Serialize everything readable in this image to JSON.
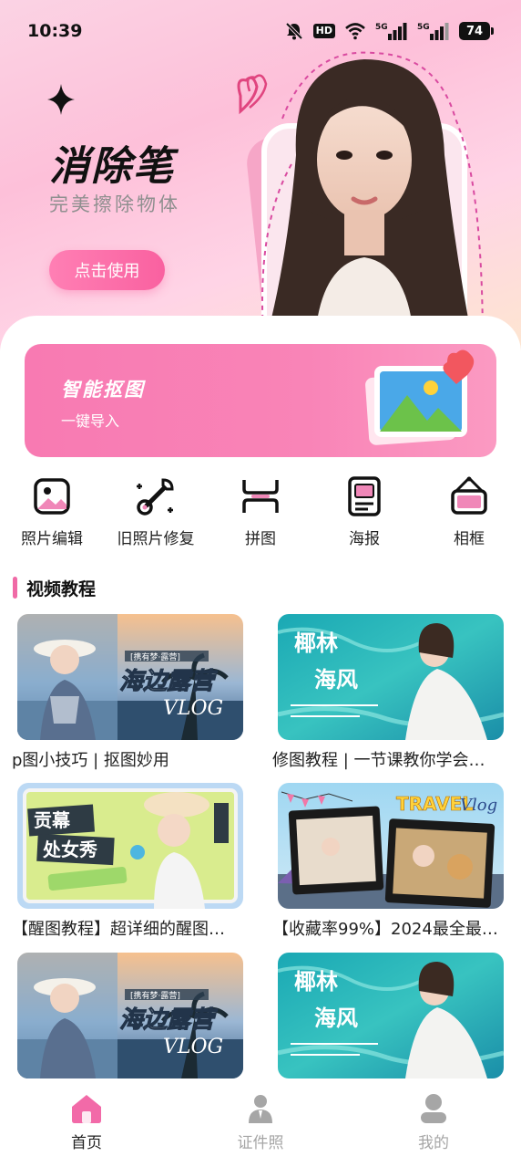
{
  "status_bar": {
    "time": "10:39",
    "hd_label": "HD",
    "battery_level": "74",
    "icons": [
      "bell-muted-icon",
      "hd-icon",
      "wifi-icon",
      "5g-signal-icon",
      "5g-signal-icon",
      "battery-icon"
    ]
  },
  "hero": {
    "title": "消除笔",
    "subtitle": "完美擦除物体",
    "button_label": "点击使用"
  },
  "cutout_card": {
    "title": "智能抠图",
    "subtitle": "一键导入"
  },
  "tools": [
    {
      "label": "照片编辑",
      "icon": "photo-edit-icon"
    },
    {
      "label": "旧照片修复",
      "icon": "wrench-icon"
    },
    {
      "label": "拼图",
      "icon": "collage-icon"
    },
    {
      "label": "海报",
      "icon": "poster-icon"
    },
    {
      "label": "相框",
      "icon": "frame-icon"
    }
  ],
  "video_section": {
    "title": "视频教程",
    "videos": [
      {
        "title": "p图小技巧 | 抠图妙用",
        "thumb_text": "海边露营",
        "thumb_text2": "VLOG"
      },
      {
        "title": "修图教程 | 一节课教你学会…",
        "thumb_text": "椰林",
        "thumb_text2": "海风"
      },
      {
        "title": "【醒图教程】超详细的醒图…",
        "thumb_text": "贡幕",
        "thumb_text2": "处女秀"
      },
      {
        "title": "【收藏率99%】2024最全最…",
        "thumb_text": "TRAVEL",
        "thumb_text2": "Vlog"
      },
      {
        "title": "",
        "thumb_text": "海边露营",
        "thumb_text2": "VLOG"
      },
      {
        "title": "",
        "thumb_text": "椰林",
        "thumb_text2": "海风"
      }
    ]
  },
  "bottom_nav": [
    {
      "label": "首页",
      "icon": "home-icon",
      "active": true
    },
    {
      "label": "证件照",
      "icon": "id-photo-icon",
      "active": false
    },
    {
      "label": "我的",
      "icon": "profile-icon",
      "active": false
    }
  ],
  "colors": {
    "accent_pink": "#f87ab2",
    "hero_button": "#f961a0",
    "inactive_nav": "#a6a6a6"
  }
}
